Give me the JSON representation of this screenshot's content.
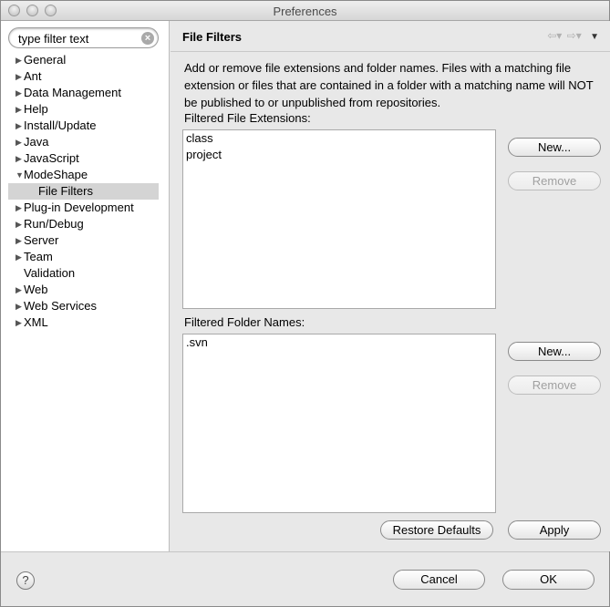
{
  "window": {
    "title": "Preferences"
  },
  "filter": {
    "placeholder": "type filter text",
    "value": "type filter text",
    "clear_icon": "clear-icon"
  },
  "tree": {
    "items": [
      {
        "label": "General",
        "expanded": false
      },
      {
        "label": "Ant",
        "expanded": false
      },
      {
        "label": "Data Management",
        "expanded": false
      },
      {
        "label": "Help",
        "expanded": false
      },
      {
        "label": "Install/Update",
        "expanded": false
      },
      {
        "label": "Java",
        "expanded": false
      },
      {
        "label": "JavaScript",
        "expanded": false
      },
      {
        "label": "ModeShape",
        "expanded": true
      },
      {
        "label": "File Filters",
        "selected": true
      },
      {
        "label": "Plug-in Development",
        "expanded": false
      },
      {
        "label": "Run/Debug",
        "expanded": false
      },
      {
        "label": "Server",
        "expanded": false
      },
      {
        "label": "Team",
        "expanded": false
      },
      {
        "label": "Validation"
      },
      {
        "label": "Web",
        "expanded": false
      },
      {
        "label": "Web Services",
        "expanded": false
      },
      {
        "label": "XML",
        "expanded": false
      }
    ]
  },
  "page": {
    "title": "File Filters",
    "description": "Add or remove file extensions and folder names. Files with a matching file extension or files that are contained in a folder with a matching name will NOT be published to or unpublished from repositories.",
    "extensions": {
      "label": "Filtered File Extensions:",
      "items": [
        "class",
        "project"
      ],
      "new_label": "New...",
      "remove_label": "Remove"
    },
    "folders": {
      "label": "Filtered Folder Names:",
      "items": [
        ".svn"
      ],
      "new_label": "New...",
      "remove_label": "Remove"
    },
    "restore_defaults_label": "Restore Defaults",
    "apply_label": "Apply"
  },
  "footer": {
    "help_glyph": "?",
    "cancel_label": "Cancel",
    "ok_label": "OK"
  }
}
